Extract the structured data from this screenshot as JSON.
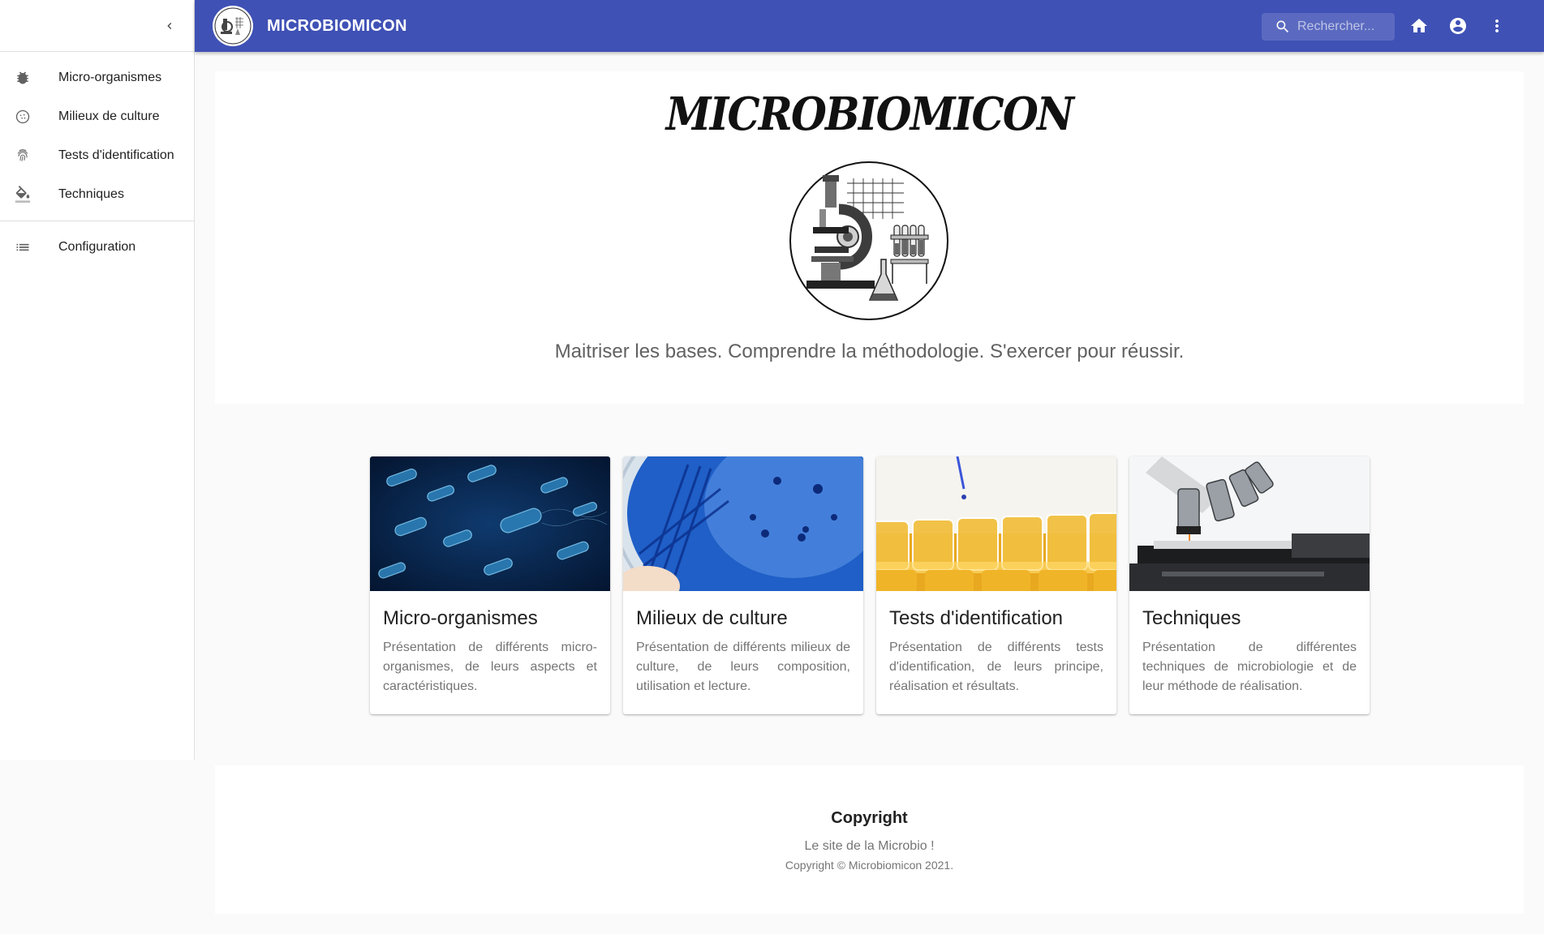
{
  "topbar": {
    "brand": "MICROBIOMICON",
    "search_placeholder": "Rechercher...",
    "accent": "#3f51b5"
  },
  "sidebar": {
    "items": [
      {
        "label": "Micro-organismes",
        "icon": "bug-icon"
      },
      {
        "label": "Milieux de culture",
        "icon": "petri-dish-icon"
      },
      {
        "label": "Tests d'identification",
        "icon": "fingerprint-icon"
      },
      {
        "label": "Techniques",
        "icon": "paint-bucket-icon"
      },
      {
        "label": "Configuration",
        "icon": "list-icon"
      }
    ]
  },
  "hero": {
    "title": "MICROBIOMICON",
    "tagline": "Maitriser les bases. Comprendre la méthodologie. S'exercer pour réussir."
  },
  "cards": [
    {
      "title": "Micro-organismes",
      "description": "Présentation de différents micro-organismes, de leurs aspects et caractéristiques."
    },
    {
      "title": "Milieux de culture",
      "description": "Présentation de différents milieux de culture, de leurs composition, utilisation et lecture."
    },
    {
      "title": "Tests d'identification",
      "description": "Présentation de différents tests d'identification, de leurs principe, réalisation et résultats."
    },
    {
      "title": "Techniques",
      "description": "Présentation de différentes techniques de microbiologie et de leur méthode de réalisation."
    }
  ],
  "footer": {
    "title": "Copyright",
    "subtitle": "Le site de la Microbio !",
    "copyright": "Copyright © Microbiomicon 2021."
  }
}
